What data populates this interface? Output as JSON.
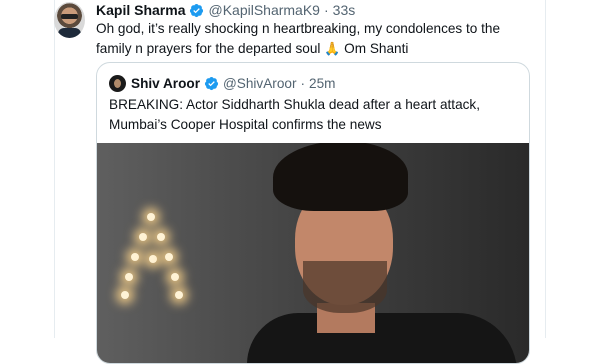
{
  "tweet": {
    "author_name": "Kapil Sharma",
    "handle": "@KapilSharmaK9",
    "separator": "·",
    "time": "33s",
    "text": "Oh god, it’s really shocking n heartbreaking, my condolences to the family n prayers for the departed soul",
    "emoji": "🙏",
    "text_end": "Om Shanti"
  },
  "quoted_tweet": {
    "author_name": "Shiv Aroor",
    "handle": "@ShivAroor",
    "separator": "·",
    "time": "25m",
    "text": "BREAKING: Actor Siddharth Shukla dead after a heart attack, Mumbai’s Cooper Hospital confirms the news"
  },
  "colors": {
    "verified_blue": "#1d9bf0",
    "meta_gray": "#536471",
    "border": "#cfd9de"
  }
}
